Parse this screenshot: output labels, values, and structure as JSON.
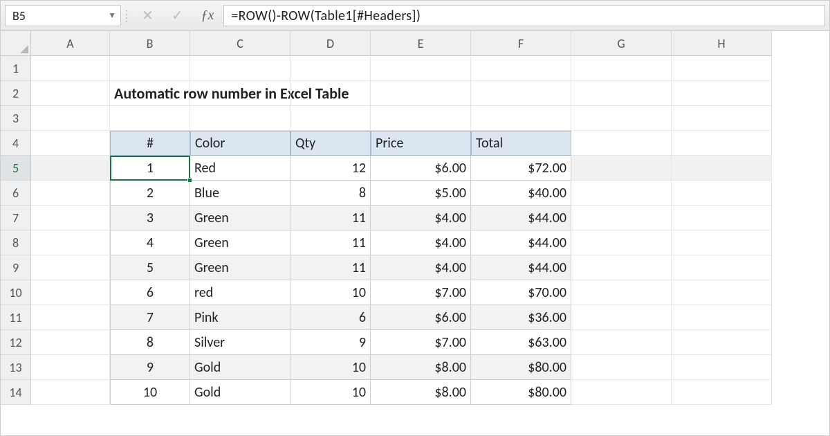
{
  "namebox": "B5",
  "formula": "=ROW()-ROW(Table1[#Headers])",
  "columns": [
    "A",
    "B",
    "C",
    "D",
    "E",
    "F",
    "G",
    "H"
  ],
  "rows": [
    "1",
    "2",
    "3",
    "4",
    "5",
    "6",
    "7",
    "8",
    "9",
    "10",
    "11",
    "12",
    "13",
    "14"
  ],
  "title": "Automatic row number in Excel Table",
  "table": {
    "headers": {
      "num": "#",
      "color": "Color",
      "qty": "Qty",
      "price": "Price",
      "total": "Total"
    },
    "rows": [
      {
        "n": "1",
        "color": "Red",
        "qty": "12",
        "price": "$6.00",
        "total": "$72.00"
      },
      {
        "n": "2",
        "color": "Blue",
        "qty": "8",
        "price": "$5.00",
        "total": "$40.00"
      },
      {
        "n": "3",
        "color": "Green",
        "qty": "11",
        "price": "$4.00",
        "total": "$44.00"
      },
      {
        "n": "4",
        "color": "Green",
        "qty": "11",
        "price": "$4.00",
        "total": "$44.00"
      },
      {
        "n": "5",
        "color": "Green",
        "qty": "11",
        "price": "$4.00",
        "total": "$44.00"
      },
      {
        "n": "6",
        "color": "red",
        "qty": "10",
        "price": "$7.00",
        "total": "$70.00"
      },
      {
        "n": "7",
        "color": "Pink",
        "qty": "6",
        "price": "$6.00",
        "total": "$36.00"
      },
      {
        "n": "8",
        "color": "Silver",
        "qty": "9",
        "price": "$7.00",
        "total": "$63.00"
      },
      {
        "n": "9",
        "color": "Gold",
        "qty": "10",
        "price": "$8.00",
        "total": "$80.00"
      },
      {
        "n": "10",
        "color": "Gold",
        "qty": "10",
        "price": "$8.00",
        "total": "$80.00"
      }
    ]
  },
  "selected_row": "5"
}
